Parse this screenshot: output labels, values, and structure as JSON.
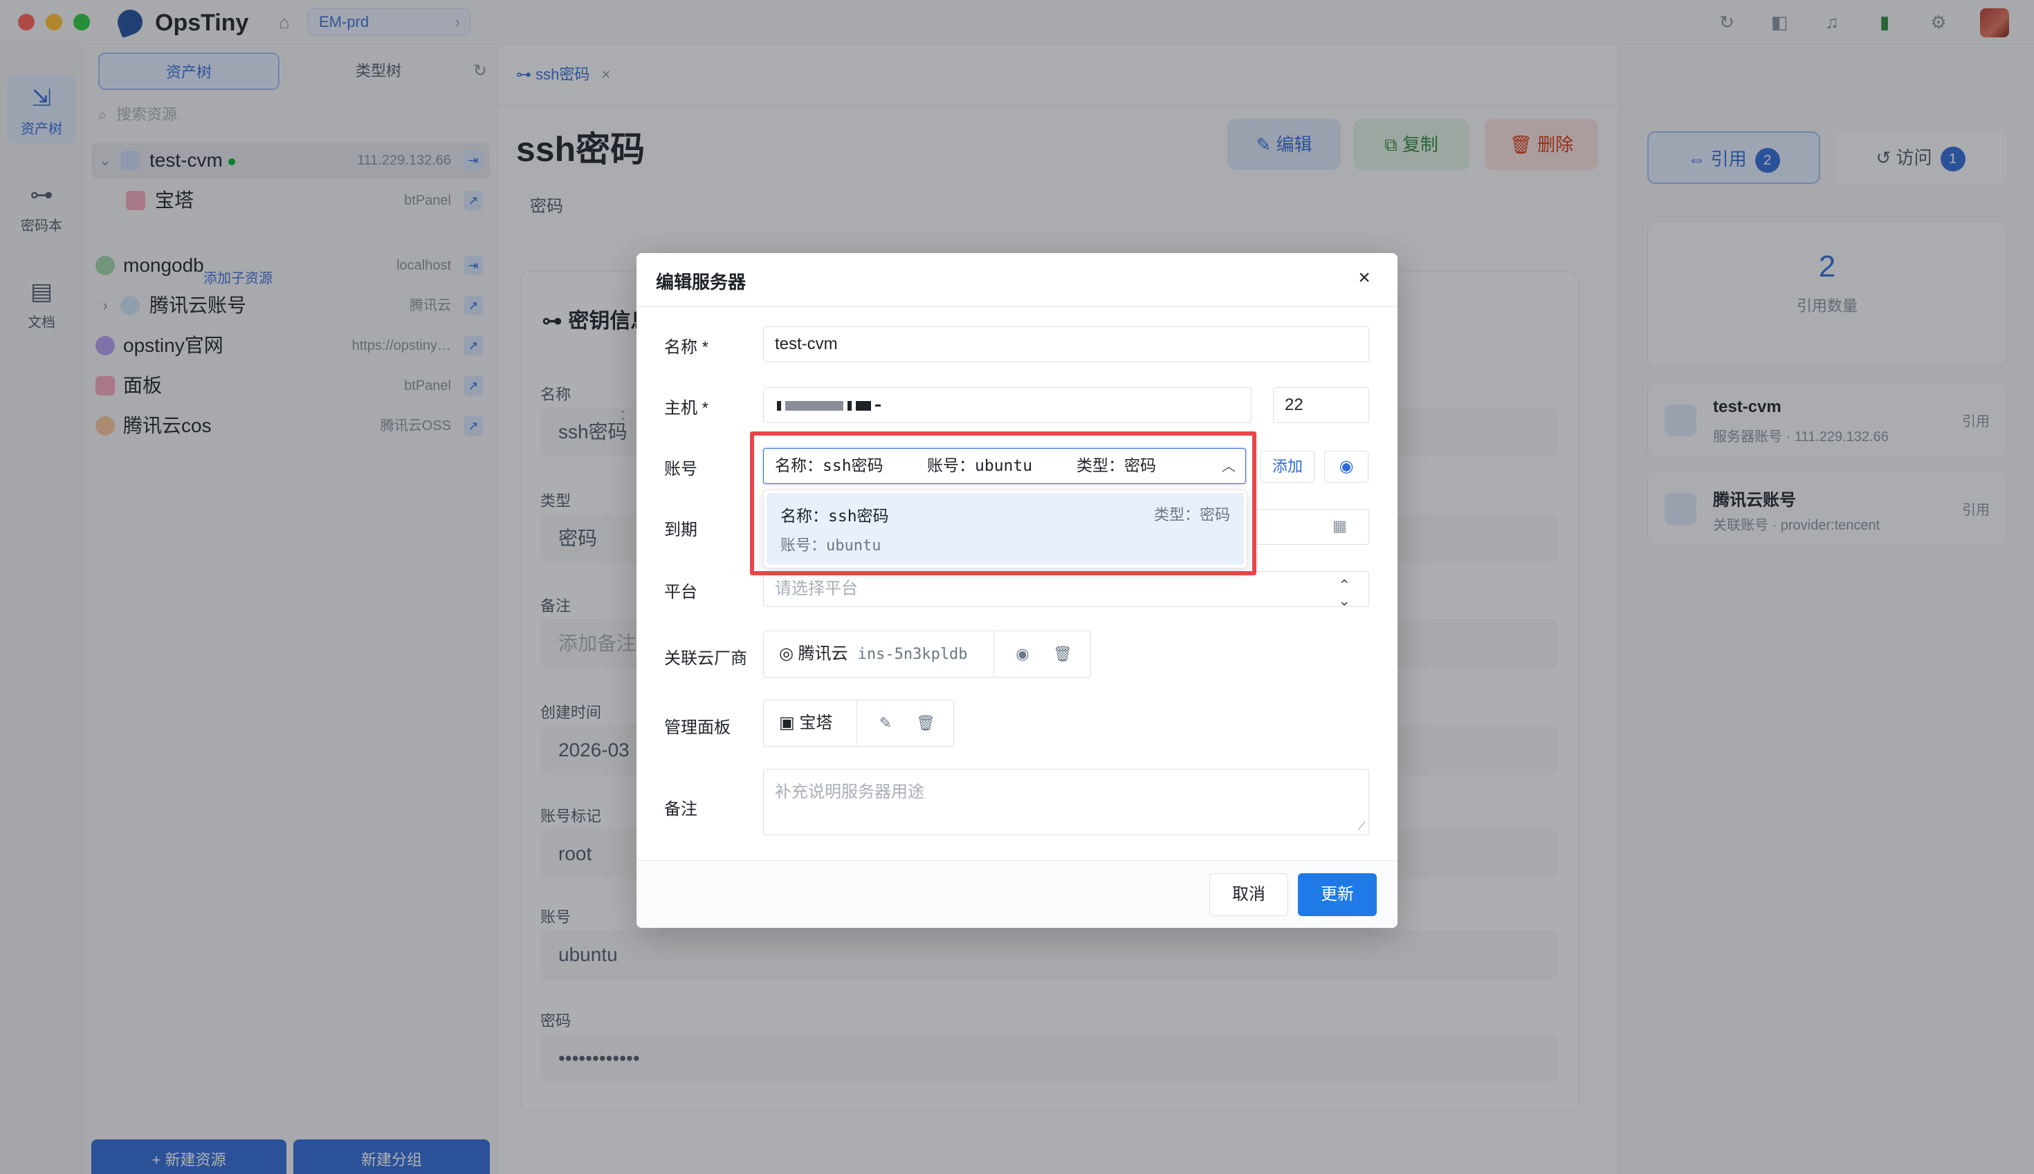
{
  "app": {
    "title": "OpsTiny",
    "env": "EM-prd",
    "env_chevron": "›"
  },
  "rail": [
    {
      "icon": "⇲",
      "label": "资产树"
    },
    {
      "icon": "⊶",
      "label": "密码本"
    },
    {
      "icon": "▤",
      "label": "文档"
    }
  ],
  "sidebar": {
    "tab_active": "资产树",
    "tab_inactive": "类型树",
    "search_placeholder": "搜索资源",
    "items": [
      {
        "label": "test-cvm",
        "meta": "111.229.132.66"
      },
      {
        "label": "宝塔",
        "meta": "btPanel"
      },
      {
        "label": "mongodb",
        "meta": "localhost"
      },
      {
        "label": "腾讯云账号",
        "meta": "腾讯云"
      },
      {
        "label": "opstiny官网",
        "meta": "https://opstiny…"
      },
      {
        "label": "面板",
        "meta": "btPanel"
      },
      {
        "label": "腾讯云cos",
        "meta": "腾讯云OSS"
      }
    ],
    "add_child": "添加子资源",
    "btn_new_asset": "+ 新建资源",
    "btn_new_group": "新建分组"
  },
  "main": {
    "tab": "ssh密码",
    "title": "ssh密码",
    "subtitle": "密码",
    "btn_edit": "编辑",
    "btn_copy": "复制",
    "btn_delete": "删除",
    "section": "密钥信息",
    "fields": [
      {
        "label": "名称",
        "value": "ssh密码"
      },
      {
        "label": "类型",
        "value": "密码"
      },
      {
        "label": "备注",
        "value": "添加备注"
      },
      {
        "label": "创建时间",
        "value": "2026-03"
      },
      {
        "label": "账号标记",
        "value": "root"
      },
      {
        "label": "账号",
        "value": "ubuntu"
      },
      {
        "label": "密码",
        "value": "••••••••••••"
      }
    ]
  },
  "right_panel": {
    "tab_ref": "引用",
    "tab_ref_count": "2",
    "tab_visit": "访问",
    "tab_visit_count": "1",
    "ref_count": "2",
    "ref_count_label": "引用数量",
    "refs": [
      {
        "title": "test-cvm",
        "sub": "服务器账号 · 111.229.132.66",
        "action": "引用"
      },
      {
        "title": "腾讯云账号",
        "sub": "关联账号 · provider:tencent",
        "action": "引用"
      }
    ]
  },
  "modal": {
    "title": "编辑服务器",
    "close": "×",
    "name_label": "名称 *",
    "name_value": "test-cvm",
    "host_label": "主机 *",
    "port_value": "22",
    "port_sep": ":",
    "account_label": "账号",
    "account_name": "名称：ssh密码",
    "account_user": "账号：ubuntu",
    "account_type": "类型：密码",
    "btn_add": "添加",
    "expiry_label": "到期",
    "platform_label": "平台",
    "platform_placeholder": "请选择平台",
    "cloud_label": "关联云厂商",
    "cloud_name": "腾讯云",
    "cloud_instance": "ins-5n3kpldb",
    "panel_label": "管理面板",
    "panel_name": "宝塔",
    "note_label": "备注",
    "note_placeholder": "补充说明服务器用途",
    "btn_cancel": "取消",
    "btn_update": "更新",
    "dropdown": {
      "name": "名称：ssh密码",
      "type": "类型：密码",
      "account": "账号：ubuntu"
    }
  },
  "colors": {
    "accent": "#1f7ae8",
    "highlight": "#e8474a"
  }
}
